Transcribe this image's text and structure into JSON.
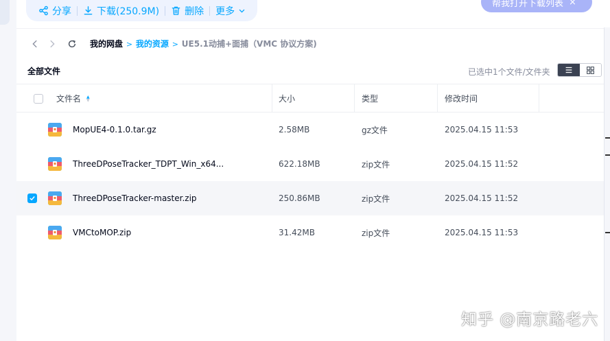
{
  "toolbar": {
    "share_label": "分享",
    "download_label": "下载(250.9M)",
    "delete_label": "删除",
    "more_label": "更多"
  },
  "download_popup": {
    "label": "帮我打开下载列表",
    "close": "×"
  },
  "breadcrumb": {
    "root": "我的网盘",
    "link": "我的资源",
    "current": "UE5.1动捕+面捕（VMC 协议方案)",
    "separator": ">"
  },
  "header": {
    "all_files": "全部文件",
    "selection_info": "已选中1个文件/文件夹"
  },
  "columns": {
    "name": "文件名",
    "size": "大小",
    "type": "类型",
    "modified": "修改时间"
  },
  "files": [
    {
      "name": "MopUE4-0.1.0.tar.gz",
      "size": "2.58MB",
      "type": "gz文件",
      "modified": "2025.04.15 11:53",
      "selected": false
    },
    {
      "name": "ThreeDPoseTracker_TDPT_Win_x64...",
      "size": "622.18MB",
      "type": "zip文件",
      "modified": "2025.04.15 11:52",
      "selected": false
    },
    {
      "name": "ThreeDPoseTracker-master.zip",
      "size": "250.86MB",
      "type": "zip文件",
      "modified": "2025.04.15 11:52",
      "selected": true
    },
    {
      "name": "VMCtoMOP.zip",
      "size": "31.42MB",
      "type": "zip文件",
      "modified": "2025.04.15 11:53",
      "selected": false
    }
  ],
  "watermark": "知乎 @南京路老六",
  "colors": {
    "accent": "#06a7ff",
    "toolbar_bg": "#eef3fe",
    "popup_bg": "#a9b4f8",
    "selected_row_bg": "#f5f6f9"
  }
}
